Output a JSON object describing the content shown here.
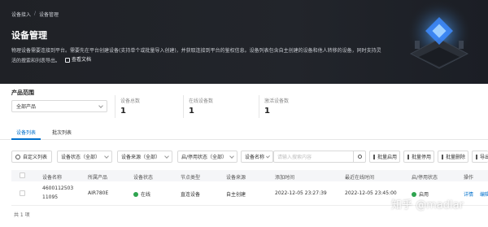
{
  "breadcrumb": {
    "parent": "设备接入",
    "separator": "/",
    "current": "设备管理"
  },
  "header": {
    "title": "设备管理",
    "description": "物理设备需要连接到平台。需要先在平台创建设备(支持单个或批量导入创建)，并获取连接到平台的鉴权信息。设备列表包含自主创建的设备和他人转移的设备，同时支持灵活的搜索和列表导出。",
    "doc_link": "查看文档"
  },
  "scope": {
    "title": "产品范围",
    "product_select": "全部产品"
  },
  "stats": [
    {
      "label": "设备总数",
      "value": "1"
    },
    {
      "label": "在线设备数",
      "value": "1"
    },
    {
      "label": "激活设备数",
      "value": "1"
    }
  ],
  "tabs": [
    {
      "label": "设备列表",
      "active": true
    },
    {
      "label": "批次列表",
      "active": false
    }
  ],
  "toolbar": {
    "custom_columns": "自定义列表",
    "status_filter": "设备状态（全部）",
    "source_filter": "设备来源（全部）",
    "enable_filter": "启/停用状态（全部）",
    "search_field": "设备名称",
    "search_placeholder": "请输入搜索内容",
    "batch_enable": "批量启用",
    "batch_disable": "批量停用",
    "batch_delete": "批量删除",
    "export": "导出"
  },
  "table": {
    "columns": [
      "设备名称",
      "所属产品",
      "设备状态",
      "节点类型",
      "设备来源",
      "添加时间",
      "最近在线时间",
      "启/停用状态",
      "操作"
    ],
    "rows": [
      {
        "name_line1": "4600112503",
        "name_line2": "11095",
        "product": "AIR780E",
        "status": "在线",
        "node_type": "直连设备",
        "source": "自主创建",
        "added": "2022-12-05 23:27:39",
        "last_online": "2022-12-05 23:45:00",
        "enabled": "启用",
        "actions": [
          "详情",
          "编辑"
        ]
      }
    ]
  },
  "footer": {
    "total": "共 1 项"
  },
  "watermark": "知乎 @madlar",
  "colors": {
    "accent": "#0070cc",
    "online": "#2ea44f",
    "banner": "#1f2126"
  }
}
